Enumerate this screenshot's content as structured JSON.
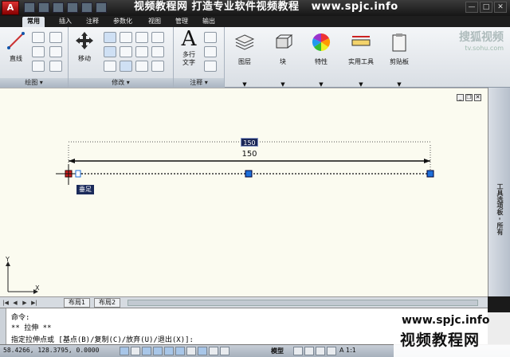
{
  "title_bar": {
    "app_button": "A",
    "banner_text": "视频教程网 打造专业软件视频教程",
    "banner_url": "www.spjc.info",
    "controls": [
      "—",
      "□",
      "✕"
    ]
  },
  "ribbon_tabs": [
    "常用",
    "插入",
    "注释",
    "参数化",
    "视图",
    "管理",
    "输出"
  ],
  "ribbon": {
    "draw_panel": {
      "title": "绘图",
      "line_label": "直线"
    },
    "modify_panel": {
      "title": "修改",
      "move_label": "移动"
    },
    "annotation_panel": {
      "title": "注释",
      "mtext_label": "多行\n文字"
    },
    "layers_label": "图层",
    "block_label": "块",
    "properties_label": "特性",
    "utilities_label": "实用工具",
    "clipboard_label": "剪贴板",
    "sohu_logo": "搜狐视频",
    "sohu_url": "tv.sohu.com"
  },
  "drawing": {
    "dim_input_value": "150",
    "dim_text": "150",
    "tooltip": "垂足",
    "palette_label": "工具选项板 - 所有"
  },
  "layout_tabs": [
    "布局1",
    "布局2"
  ],
  "command_line": {
    "line1": "命令:",
    "line2": "** 拉伸 **",
    "line3": "指定拉伸点或 [基点(B)/复制(C)/放弃(U)/退出(X)]:"
  },
  "status_bar": {
    "coords": "58.4266, 128.3795, 0.0000",
    "model_label": "模型",
    "scale_label": "A 1:1"
  },
  "watermark": {
    "url": "www.spjc.info",
    "name": "视频教程网"
  },
  "colors": {
    "canvas_bg": "#fbfbf0",
    "grip_blue": "#1e6fd9",
    "grip_red": "#d42020",
    "ribbon_bg": "#e6eaef"
  }
}
